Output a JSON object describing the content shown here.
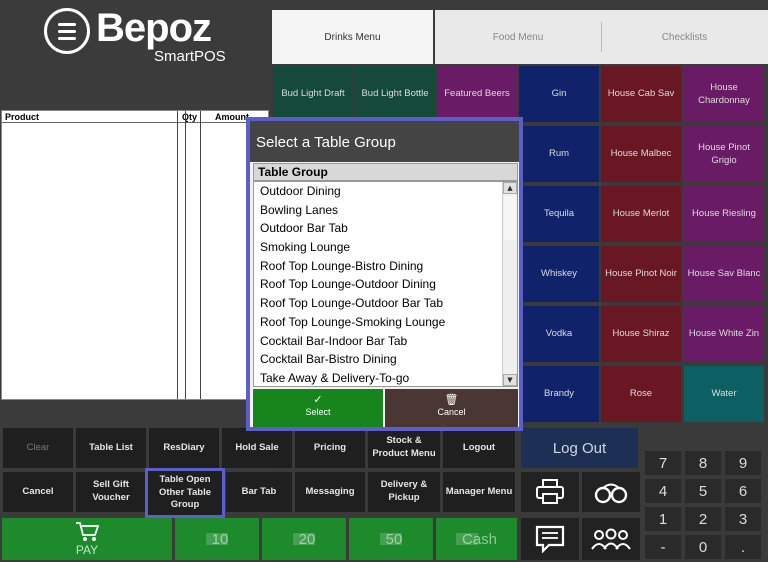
{
  "brand": {
    "name": "Bepoz",
    "sub": "SmartPOS"
  },
  "order_grid": {
    "columns": [
      "Product",
      "Qty",
      "Amount"
    ]
  },
  "tabs": [
    {
      "label": "Drinks Menu",
      "active": true
    },
    {
      "label": "Food Menu",
      "active": false
    },
    {
      "label": "Checklists",
      "active": false
    }
  ],
  "menu_buttons": [
    "Bud Light Draft",
    "Bud Light Bottle",
    "Featured Beers",
    "Gin",
    "House Cab Sav",
    "House Chardonnay",
    "Rum",
    "House Malbec",
    "House Pinot Grigio",
    "Tequila",
    "House Merlot",
    "House Riesling",
    "Whiskey",
    "House Pinot Noir",
    "House Sav Blanc",
    "Vodka",
    "House Shiraz",
    "House White Zin",
    "Brandy",
    "Rose",
    "Water"
  ],
  "dialog": {
    "title": "Select a Table Group",
    "column_header": "Table Group",
    "items": [
      "Outdoor Dining",
      "Bowling Lanes",
      "Outdoor Bar Tab",
      "Smoking Lounge",
      "Roof Top Lounge-Bistro Dining",
      "Roof Top Lounge-Outdoor Dining",
      "Roof Top Lounge-Outdoor Bar Tab",
      "Roof Top Lounge-Smoking Lounge",
      "Cocktail Bar-Indoor Bar Tab",
      "Cocktail Bar-Bistro Dining",
      "Take Away & Delivery-To-go"
    ],
    "select_label": "Select",
    "cancel_label": "Cancel"
  },
  "function_buttons": {
    "row1": [
      "Clear",
      "Table List",
      "ResDiary",
      "Hold Sale",
      "Pricing",
      "Stock & Product Menu",
      "Logout"
    ],
    "row2": [
      "Cancel",
      "Sell Gift Voucher",
      "Table Open Other Table Group",
      "Bar Tab",
      "Messaging",
      "Delivery & Pickup",
      "Manager Menu"
    ]
  },
  "pay_row": {
    "pay": "PAY",
    "b10": "10",
    "b20": "20",
    "b50": "50",
    "cash": "Cash"
  },
  "log_out": "Log Out",
  "keypad": [
    "7",
    "8",
    "9",
    "4",
    "5",
    "6",
    "1",
    "2",
    "3",
    "-",
    "0",
    "."
  ],
  "colors": {
    "accent_outline": "#5c5ec9",
    "pay_green": "#1d8b2c",
    "select_green": "#16861c"
  }
}
